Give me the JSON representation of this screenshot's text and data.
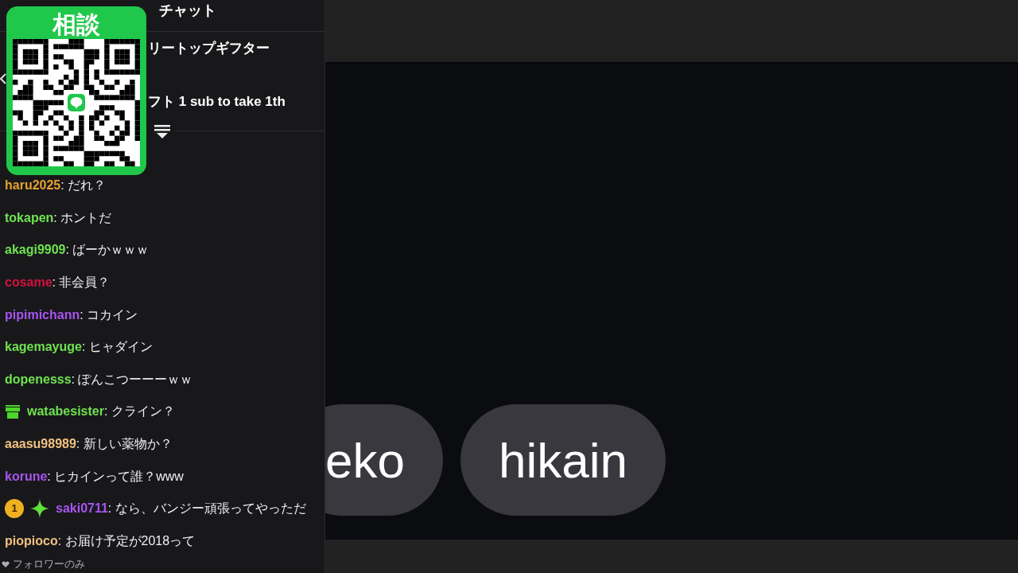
{
  "overlay": {
    "title": "相談"
  },
  "chat": {
    "title": "チャット",
    "pinned": [
      "リートップギフター",
      "フト 1 sub to take 1th"
    ],
    "messages": [
      {
        "user": "haru2025",
        "color": "#e8a030",
        "text": ": だれ？"
      },
      {
        "user": "tokapen",
        "color": "#6fe34f",
        "text": ": ホントだ"
      },
      {
        "user": "akagi9909",
        "color": "#6fe34f",
        "text": ": ばーかｗｗｗ"
      },
      {
        "user": "cosame",
        "color": "#d3123e",
        "text": ": 非会員？"
      },
      {
        "user": "pipimichann",
        "color": "#a855f0",
        "text": ": コカイン"
      },
      {
        "user": "kagemayuge",
        "color": "#6fe34f",
        "text": ": ヒャダイン"
      },
      {
        "user": "dopenesss",
        "color": "#6fe34f",
        "text": ": ぽんこつーーーｗｗ"
      },
      {
        "user": "watabesister",
        "color": "#6fe34f",
        "text": ": クライン？",
        "badges": [
          {
            "kind": "gift"
          }
        ]
      },
      {
        "user": "aaasu98989",
        "color": "#f2c27f",
        "text": ": 新しい薬物か？"
      },
      {
        "user": "korune",
        "color": "#a855f0",
        "text": ": ヒカインって誰？www"
      },
      {
        "user": "saki0711",
        "color": "#a855f0",
        "text": ": なら、バンジー頑張ってやっただ",
        "badges": [
          {
            "kind": "rank",
            "label": "1"
          },
          {
            "kind": "sparkle"
          }
        ]
      },
      {
        "user": "piopioco",
        "color": "#f2c27f",
        "text": ": お届け予定が2018って"
      }
    ],
    "footer": "フォロワーのみ"
  },
  "video": {
    "tags": [
      "eko",
      "hikain"
    ]
  }
}
